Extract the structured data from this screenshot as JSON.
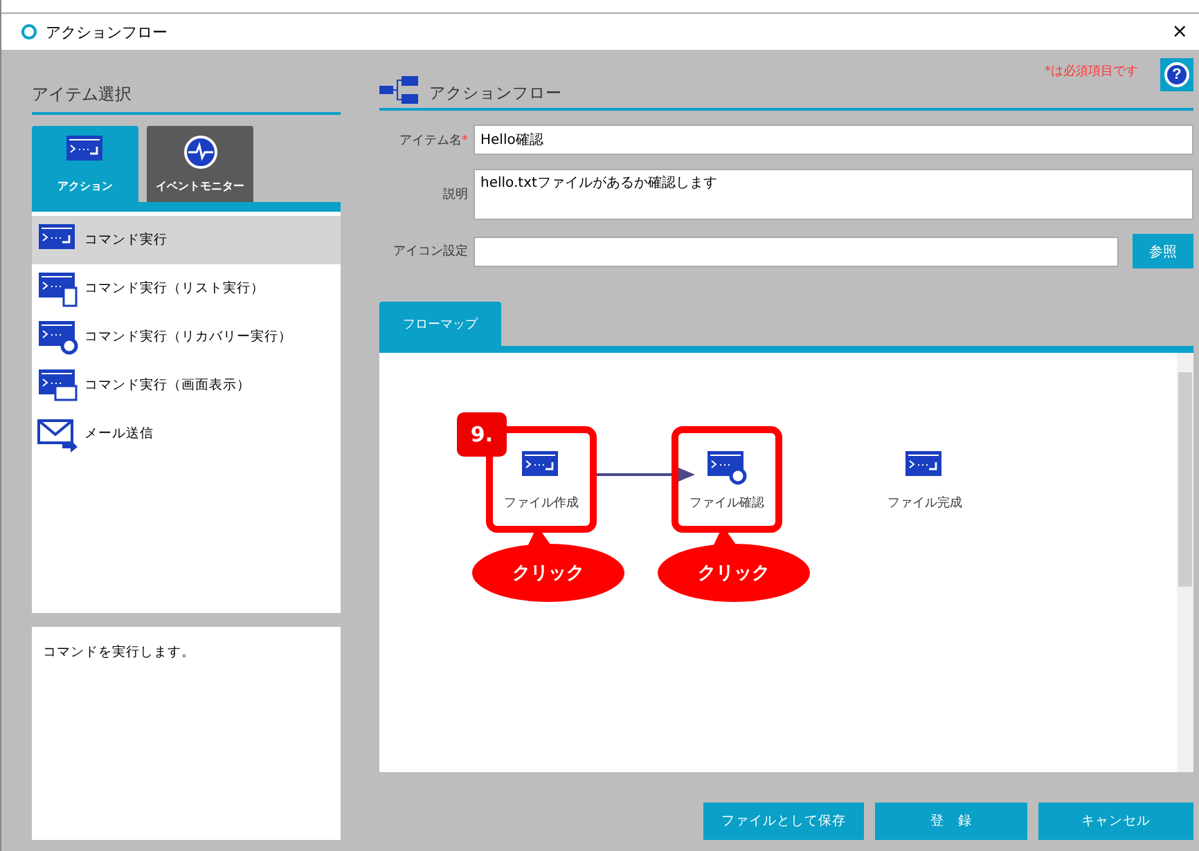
{
  "window": {
    "title": "アクションフロー",
    "close": "×"
  },
  "item_select": {
    "title": "アイテム選択",
    "tabs": [
      {
        "label": "アクション",
        "kind": "action",
        "selected": true
      },
      {
        "label": "イベントモニター",
        "kind": "monitor",
        "selected": false
      }
    ],
    "items": [
      {
        "label": "コマンド実行",
        "kind": "command",
        "selected": true
      },
      {
        "label": "コマンド実行（リスト実行）",
        "kind": "list",
        "selected": false
      },
      {
        "label": "コマンド実行（リカバリー実行）",
        "kind": "recovery",
        "selected": false
      },
      {
        "label": "コマンド実行（画面表示）",
        "kind": "screen",
        "selected": false
      },
      {
        "label": "メール送信",
        "kind": "mail",
        "selected": false
      }
    ],
    "description": "コマンドを実行します。"
  },
  "form": {
    "title": "アクションフロー",
    "required_note": "*は必須項目です",
    "help": "?",
    "required_mark": "*",
    "fields": [
      {
        "label": "アイテム名",
        "required": true,
        "value": "Hello確認",
        "kind": "text"
      },
      {
        "label": "説明",
        "required": false,
        "value": "hello.txtファイルがあるか確認します",
        "kind": "textarea"
      },
      {
        "label": "アイコン設定",
        "required": false,
        "kind": "browse",
        "button": "参照"
      }
    ]
  },
  "flow": {
    "tab": {
      "label": "フローマップ",
      "selected": true
    },
    "nodes": [
      {
        "label": "ファイル作成",
        "kind": "command",
        "highlighted": true
      },
      {
        "label": "ファイル確認",
        "kind": "recovery",
        "highlighted": true
      },
      {
        "label": "ファイル完成",
        "kind": "command",
        "highlighted": false
      }
    ],
    "step_badge": "9.",
    "callouts": [
      "クリック",
      "クリック"
    ]
  },
  "buttons": [
    "ファイルとして保存",
    "登　録",
    "キャンセル"
  ]
}
